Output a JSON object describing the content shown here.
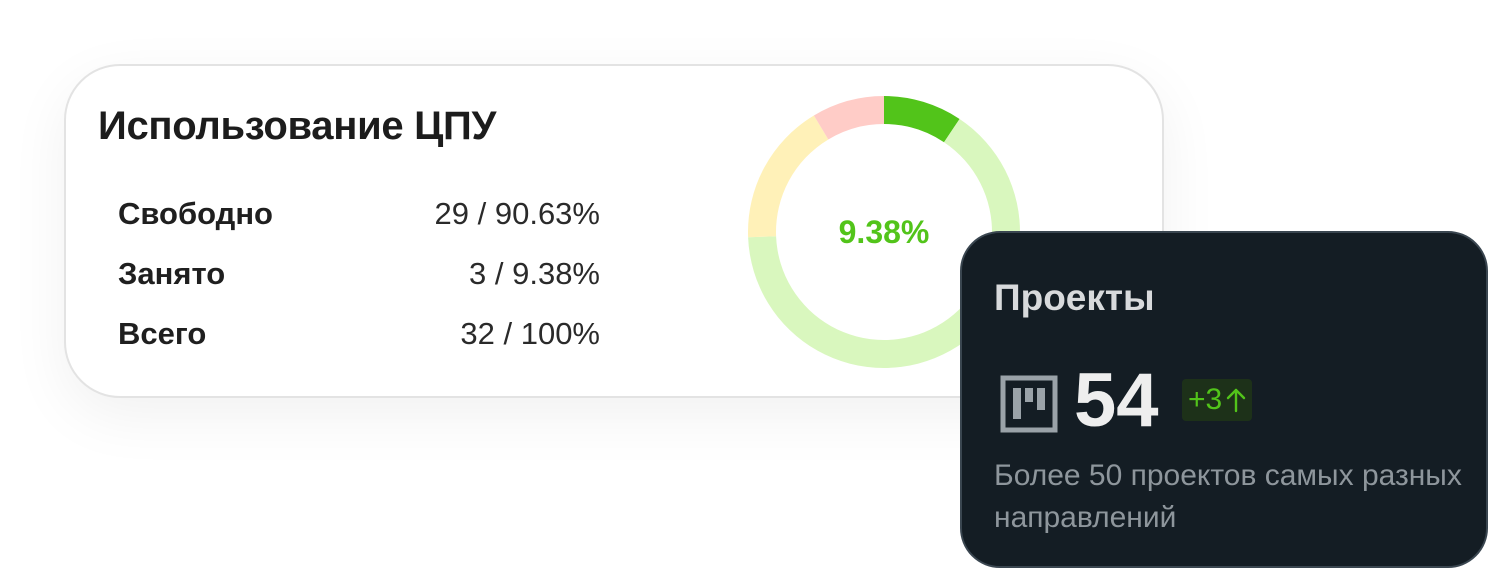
{
  "cpu": {
    "title": "Использование ЦПУ",
    "rows": [
      {
        "label": "Свободно",
        "value": "29 / 90.63%"
      },
      {
        "label": "Занято",
        "value": "3 / 9.38%"
      },
      {
        "label": "Всего",
        "value": "32 / 100%"
      }
    ],
    "center_label": "9.38%"
  },
  "chart_data": {
    "type": "pie",
    "center_label": "9.38%",
    "slices": [
      {
        "value": 9.38,
        "color": "#52c41a"
      },
      {
        "value": 65.0,
        "color": "#d9f7be"
      },
      {
        "value": 17.0,
        "color": "#fff1b8"
      },
      {
        "value": 8.62,
        "color": "#ffccc7"
      }
    ]
  },
  "projects": {
    "title": "Проекты",
    "count": "54",
    "delta": "+3",
    "description": "Более 50 проектов самых разных направлений",
    "icon": "kanban-board-icon",
    "delta_icon": "arrow-up-icon"
  },
  "colors": {
    "accent_green": "#52c41a",
    "dark_card": "#141d24"
  }
}
